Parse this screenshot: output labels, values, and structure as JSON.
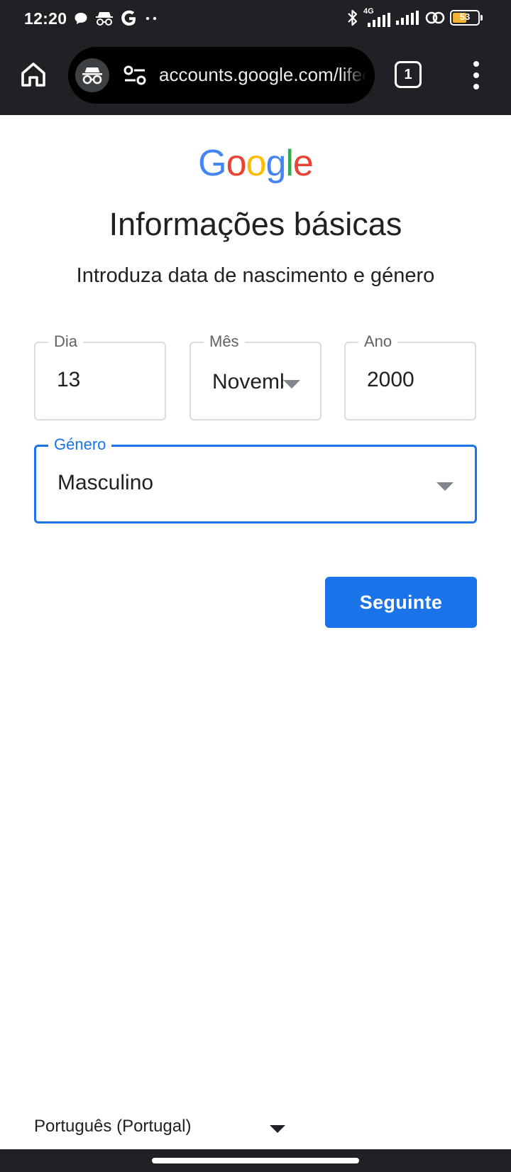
{
  "status_bar": {
    "time": "12:20",
    "network_label": "4G",
    "battery_level": "53",
    "icons": [
      "chat-bubble-icon",
      "incognito-icon",
      "google-g-icon",
      "more-dots-icon",
      "bluetooth-icon",
      "signal-4g-icon",
      "signal-icon",
      "hotspot-icon",
      "battery-icon"
    ]
  },
  "browser": {
    "url": "accounts.google.com/lifecycle",
    "tab_count": "1",
    "icons": [
      "home-icon",
      "incognito-icon",
      "site-settings-icon",
      "more-vert-icon"
    ]
  },
  "page": {
    "logo_letters": [
      "G",
      "o",
      "o",
      "g",
      "l",
      "e"
    ],
    "logo_colors": [
      "#4285F4",
      "#EA4335",
      "#FBBC05",
      "#4285F4",
      "#34A853",
      "#EA4335"
    ],
    "title": "Informações básicas",
    "subtitle": "Introduza data de nascimento e género"
  },
  "form": {
    "day": {
      "label": "Dia",
      "value": "13"
    },
    "month": {
      "label": "Mês",
      "value": "Novembro"
    },
    "year": {
      "label": "Ano",
      "value": "2000"
    },
    "gender": {
      "label": "Género",
      "value": "Masculino"
    },
    "next_label": "Seguinte"
  },
  "footer": {
    "language": "Português (Portugal)"
  },
  "colors": {
    "accent": "#1a73e8",
    "chrome_bg": "#202124"
  }
}
